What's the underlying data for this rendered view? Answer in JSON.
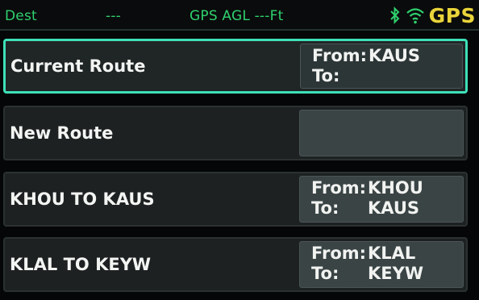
{
  "statusbar": {
    "dest_label": "Dest",
    "dest_value": "---",
    "agl_label": "GPS AGL ---Ft",
    "gps_label": "GPS",
    "colors": {
      "text": "#2fd06e",
      "gps": "#e9d43a"
    },
    "icons": [
      "bluetooth-icon",
      "wifi-icon"
    ]
  },
  "routes": [
    {
      "name": "Current Route",
      "from_label": "From:",
      "from": "KAUS",
      "to_label": "To:",
      "to": "",
      "selected": true
    },
    {
      "name": "New Route",
      "from_label": "",
      "from": "",
      "to_label": "",
      "to": "",
      "selected": false
    },
    {
      "name": "KHOU TO KAUS",
      "from_label": "From:",
      "from": "KHOU",
      "to_label": "To:",
      "to": "KAUS",
      "selected": false
    },
    {
      "name": "KLAL TO KEYW",
      "from_label": "From:",
      "from": "KLAL",
      "to_label": "To:",
      "to": "KEYW",
      "selected": false
    }
  ],
  "colors": {
    "selection": "#3ee0b8",
    "row_bg": "#1d2122",
    "info_bg": "#3a4445"
  }
}
